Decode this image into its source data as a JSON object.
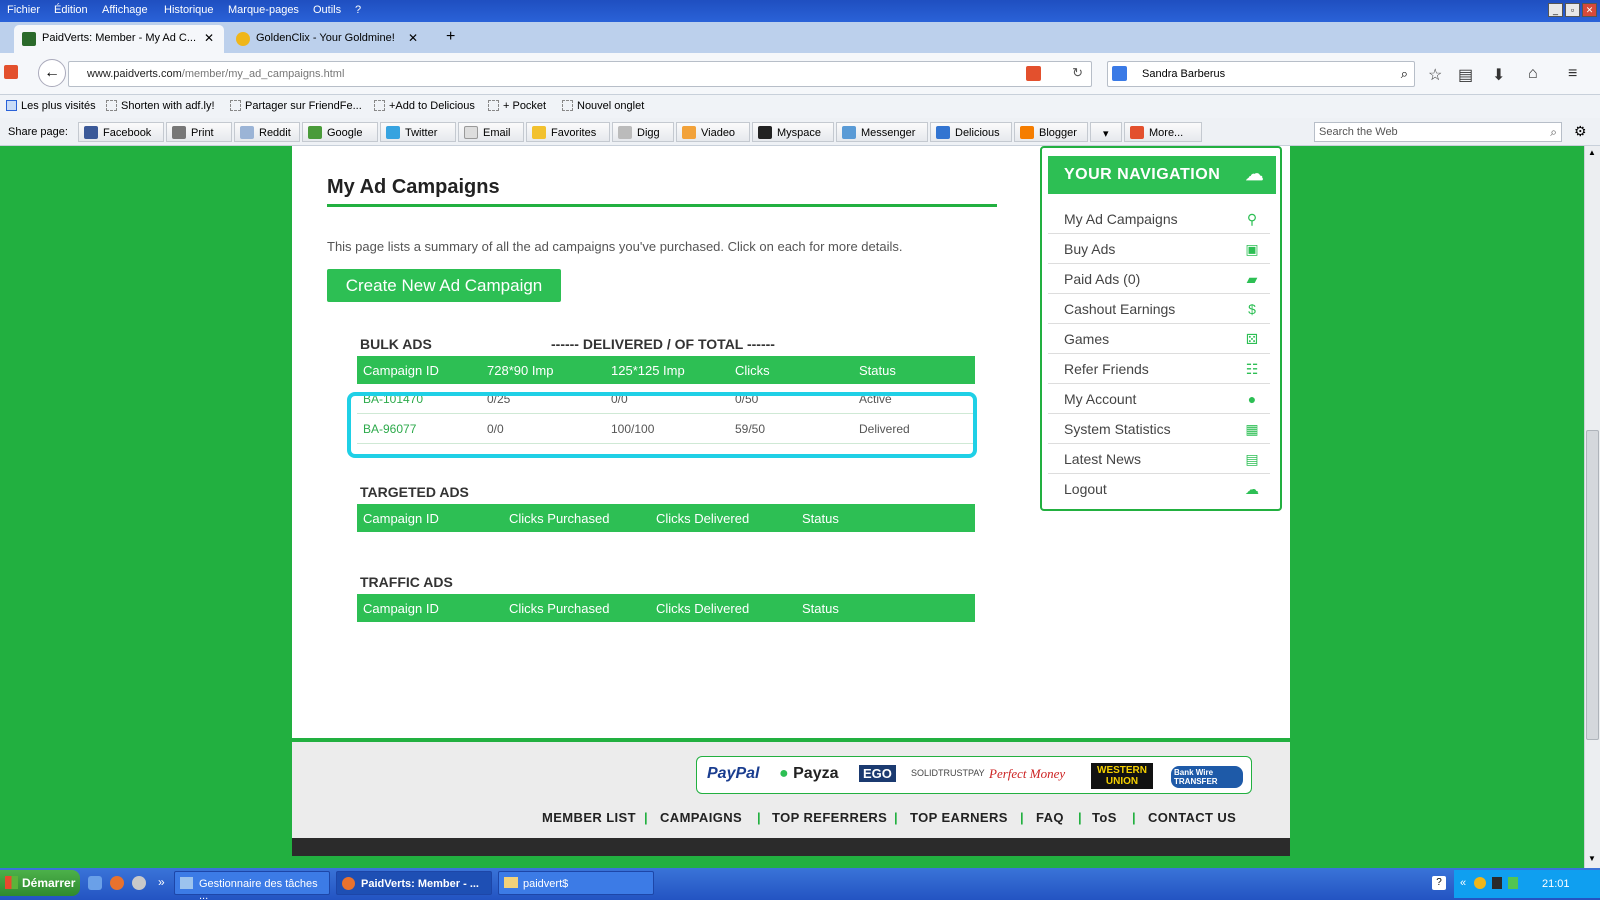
{
  "menubar": {
    "items": [
      "Fichier",
      "Édition",
      "Affichage",
      "Historique",
      "Marque-pages",
      "Outils",
      "?"
    ]
  },
  "tabs": [
    {
      "label": "PaidVerts: Member - My Ad C...",
      "active": true
    },
    {
      "label": "GoldenClix - Your Goldmine!",
      "active": false
    }
  ],
  "navbar": {
    "url_domain": "www.paidverts.com",
    "url_path": "/member/my_ad_campaigns.html",
    "search_value": "Sandra Barberus"
  },
  "bookmarks": [
    "Les plus visités",
    "Shorten with adf.ly!",
    "Partager sur FriendFe...",
    "+Add to Delicious",
    "+ Pocket",
    "Nouvel onglet"
  ],
  "sharebar": {
    "label": "Share page:",
    "buttons": [
      "Facebook",
      "Print",
      "Reddit",
      "Google",
      "Twitter",
      "Email",
      "Favorites",
      "Digg",
      "Viadeo",
      "Myspace",
      "Messenger",
      "Delicious",
      "Blogger",
      "More..."
    ],
    "search_placeholder": "Search the Web"
  },
  "main": {
    "title": "My Ad Campaigns",
    "description": "This page lists a summary of all the ad campaigns you've purchased. Click on each for more details.",
    "create_button": "Create New Ad Campaign",
    "bulk": {
      "title": "BULK ADS",
      "subtitle": "------ DELIVERED / OF TOTAL ------",
      "headers": [
        "Campaign ID",
        "728*90 Imp",
        "125*125 Imp",
        "Clicks",
        "Status"
      ],
      "rows": [
        [
          "BA-101470",
          "0/25",
          "0/0",
          "0/50",
          "Active"
        ],
        [
          "BA-96077",
          "0/0",
          "100/100",
          "59/50",
          "Delivered"
        ]
      ]
    },
    "targeted": {
      "title": "TARGETED ADS",
      "headers": [
        "Campaign ID",
        "Clicks Purchased",
        "Clicks Delivered",
        "Status"
      ]
    },
    "traffic": {
      "title": "TRAFFIC ADS",
      "headers": [
        "Campaign ID",
        "Clicks Purchased",
        "Clicks Delivered",
        "Status"
      ]
    }
  },
  "sidenav": {
    "heading": "YOUR NAVIGATION",
    "items": [
      "My Ad Campaigns",
      "Buy Ads",
      "Paid Ads (0)",
      "Cashout Earnings",
      "Games",
      "Refer Friends",
      "My Account",
      "System Statistics",
      "Latest News",
      "Logout"
    ]
  },
  "footer": {
    "payments": [
      "PayPal",
      "Payza",
      "EGO",
      "SOLIDTRUSTPAY",
      "Perfect Money",
      "WESTERN UNION",
      "Bank Wire TRANSFER"
    ],
    "links": [
      "MEMBER LIST",
      "CAMPAIGNS",
      "TOP REFERRERS",
      "TOP EARNERS",
      "FAQ",
      "ToS",
      "CONTACT US"
    ]
  },
  "taskbar": {
    "start": "Démarrer",
    "tasks": [
      "Gestionnaire des tâches ...",
      "PaidVerts: Member - ...",
      "paidvert$"
    ],
    "clock": "21:01"
  },
  "colors": {
    "brand_green": "#22b040",
    "button_green": "#2dbf54",
    "highlight": "#1fd0e6"
  }
}
